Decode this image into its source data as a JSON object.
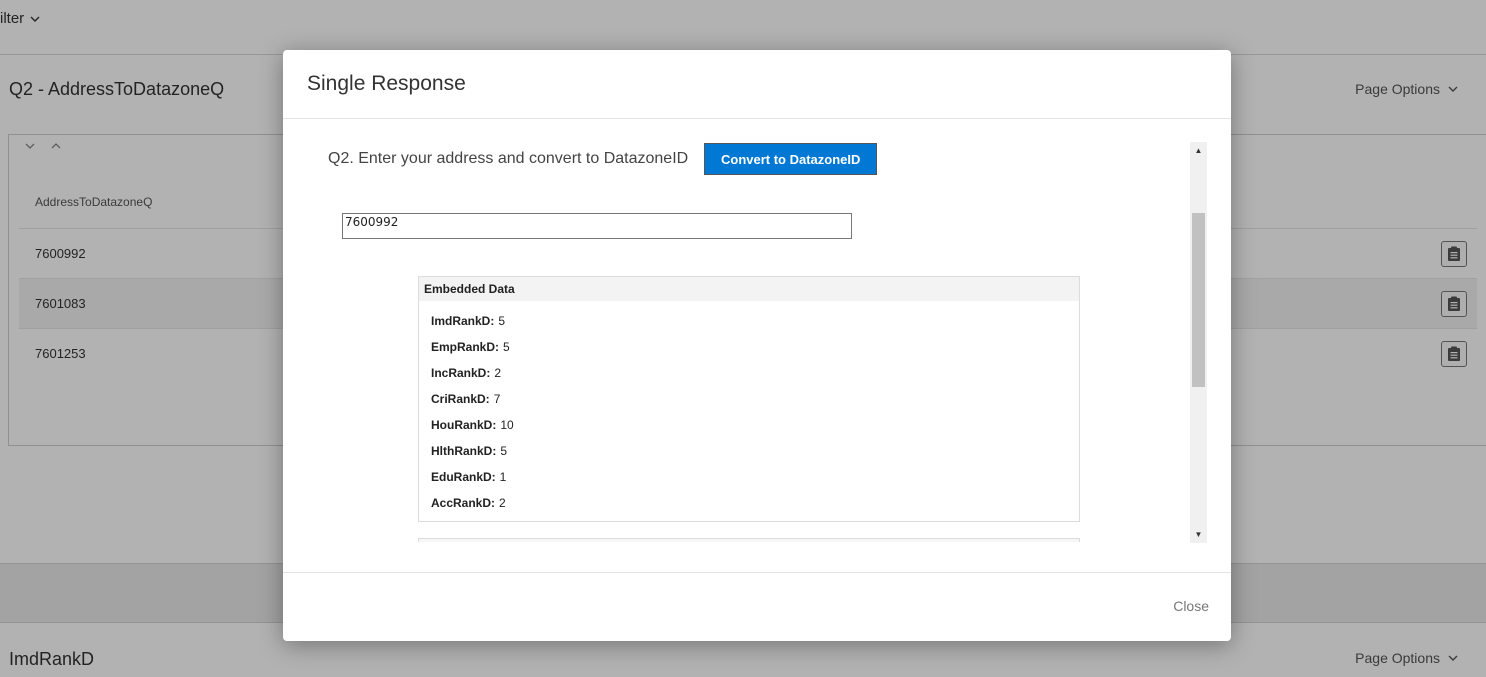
{
  "background": {
    "filter_label": "ilter",
    "section1_title": "Q2 - AddressToDatazoneQ",
    "page_options_label": "Page Options",
    "column_header": "AddressToDatazoneQ",
    "rows": [
      "7600992",
      "7601083",
      "7601253"
    ],
    "section2_title": "ImdRankD"
  },
  "modal": {
    "title": "Single Response",
    "question_text": "Q2. Enter your address and convert to DatazoneID",
    "convert_button": "Convert to DatazoneID",
    "answer_value": "7600992",
    "embedded_title": "Embedded Data",
    "embedded": [
      {
        "key": "ImdRankD:",
        "value": "5"
      },
      {
        "key": "EmpRankD:",
        "value": "5"
      },
      {
        "key": "IncRankD:",
        "value": "2"
      },
      {
        "key": "CriRankD:",
        "value": "7"
      },
      {
        "key": "HouRankD:",
        "value": "10"
      },
      {
        "key": "HlthRankD:",
        "value": "5"
      },
      {
        "key": "EduRankD:",
        "value": "1"
      },
      {
        "key": "AccRankD:",
        "value": "2"
      }
    ],
    "close_label": "Close"
  },
  "colors": {
    "accent": "#0078d4",
    "overlay": "rgba(0,0,0,0.30)"
  }
}
